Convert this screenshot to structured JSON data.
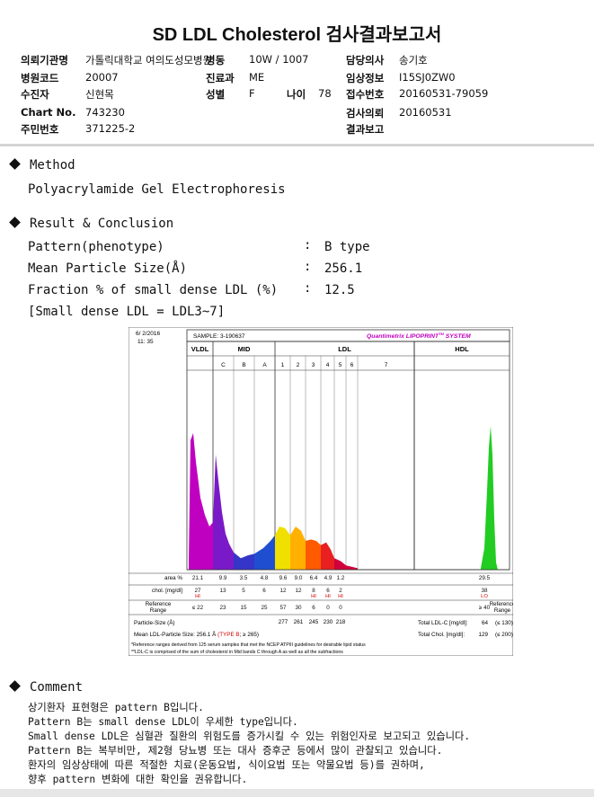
{
  "report": {
    "title": "SD LDL Cholesterol 검사결과보고서",
    "fields": {
      "institution": {
        "label": "의뢰기관명",
        "value": "가톨릭대학교 여의도성모병원"
      },
      "ward_label": "병동",
      "ward_value": "10W / 1007",
      "doctor": {
        "label": "담당의사",
        "value": "송기호"
      },
      "hospital_code": {
        "label": "병원코드",
        "value": "20007"
      },
      "department": {
        "label": "진료과",
        "value": "ME"
      },
      "clinical_info": {
        "label": "임상정보",
        "value": "I15SJ0ZW0"
      },
      "patient": {
        "label": "수진자",
        "value": "신현목"
      },
      "sex": {
        "label": "성별",
        "value": "F"
      },
      "age": {
        "label": "나이",
        "value": "78"
      },
      "receipt_no": {
        "label": "접수번호",
        "value": "20160531-79059"
      },
      "chart_no": {
        "label": "Chart No.",
        "value": "743230"
      },
      "test_request": {
        "label": "검사의뢰",
        "value": "20160531"
      },
      "resident_no": {
        "label": "주민번호",
        "value": "371225-2"
      },
      "result_report": {
        "label": "결과보고",
        "value": ""
      }
    }
  },
  "method": {
    "heading": "Method",
    "text": "Polyacrylamide Gel Electrophoresis"
  },
  "result": {
    "heading": "Result & Conclusion",
    "rows": [
      {
        "label": "Pattern(phenotype)",
        "sep": ":",
        "value": "B type"
      },
      {
        "label": "Mean Particle Size(Å)",
        "sep": ":",
        "value": "256.1"
      },
      {
        "label": "Fraction % of small dense LDL (%)",
        "sep": ":",
        "value": "12.5"
      }
    ],
    "note": "[Small dense LDL = LDL3~7]"
  },
  "chart_data": {
    "type": "area",
    "header": {
      "date": "6/ 2/2016",
      "time": "11: 35",
      "sample": "SAMPLE:  3-190637",
      "brand": "Quantimetrix LIPOPRINT",
      "brand_sup": "TM",
      "brand_suffix": " SYSTEM"
    },
    "groups": [
      "VLDL",
      "MID",
      "LDL",
      "HDL"
    ],
    "bands": [
      "C",
      "B",
      "A",
      "1",
      "2",
      "3",
      "4",
      "5",
      "6",
      "7"
    ],
    "rows": [
      {
        "label": "area %",
        "values": [
          "21.1",
          "9.9",
          "3.5",
          "4.8",
          "9.6",
          "9.0",
          "6.4",
          "4.9",
          "1.2",
          "",
          "29.5"
        ]
      },
      {
        "label": "chol. [mg/dl]",
        "values": [
          "27",
          "13",
          "5",
          "6",
          "12",
          "12",
          "8",
          "6",
          "2",
          "",
          "38"
        ]
      },
      {
        "label": "",
        "values": [
          "HI",
          "",
          "",
          "",
          "",
          "",
          "HI",
          "HI",
          "HI",
          "",
          "LO"
        ]
      },
      {
        "label": "Reference Range",
        "values": [
          "≤ 22",
          "23",
          "15",
          "25",
          "57",
          "30",
          "6",
          "0",
          "0",
          "",
          "≥ 40"
        ]
      },
      {
        "label": "Particle-Size (Å)",
        "values": [
          "",
          "",
          "",
          "",
          "277",
          "261",
          "245",
          "230",
          "218",
          "",
          ""
        ]
      }
    ],
    "ref_label_right": "Reference Range",
    "totals": [
      {
        "label": "Total LDL-C [mg/dl]:",
        "value": "64",
        "ref": "(≤ 130)"
      },
      {
        "label": "Total Chol. [mg/dl]:",
        "value": "129",
        "ref": "(≤ 200)"
      }
    ],
    "mean_size": "Mean LDL-Particle Size:    256.1 Å",
    "mean_type": "(TYPE B",
    "mean_ref": "; ≥ 265)",
    "footnotes": [
      "*Reference ranges derived from 125 serum samples that met the NCEP ATPIII guidelines for desirable lipid status",
      "**LDL-C is comprised of the sum of cholesterol in Mid bands C through A as well as all the subfractions"
    ],
    "band_colors": {
      "vldl": "#c000c0",
      "mid_c": "#7a19c8",
      "mid_b": "#3535c8",
      "mid_a": "#1f4fd0",
      "ldl1": "#f0e000",
      "ldl2": "#ffb000",
      "ldl3": "#ff5a00",
      "ldl4": "#e82020",
      "ldl5": "#d0003c",
      "hdl": "#22cc22"
    }
  },
  "comment": {
    "heading": "Comment",
    "lines": [
      "상기환자 표현형은 pattern B입니다.",
      "Pattern B는 small dense LDL이 우세한 type입니다.",
      "Small dense LDL은 심혈관 질환의 위험도를 증가시킬 수 있는 위험인자로 보고되고 있습니다.",
      "Pattern B는 복부비만, 제2형 당뇨병 또는 대사 증후군 등에서 많이 관찰되고 있습니다.",
      "환자의 임상상태에 따른 적절한 치료(운동요법, 식이요법 또는 약물요법 등)를 권하며,",
      "향후 pattern 변화에 대한 확인을 권유합니다."
    ]
  }
}
